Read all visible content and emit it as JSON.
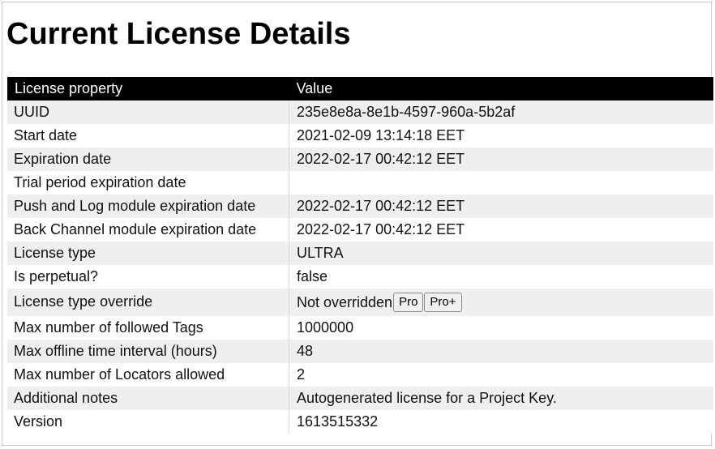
{
  "page": {
    "title": "Current License Details"
  },
  "table": {
    "headers": {
      "property": "License property",
      "value": "Value"
    },
    "rows": [
      {
        "property": "UUID",
        "value": "235e8e8a-8e1b-4597-960a-5b2af"
      },
      {
        "property": "Start date",
        "value": "2021-02-09 13:14:18 EET"
      },
      {
        "property": "Expiration date",
        "value": "2022-02-17 00:42:12 EET"
      },
      {
        "property": "Trial period expiration date",
        "value": ""
      },
      {
        "property": "Push and Log module expiration date",
        "value": "2022-02-17 00:42:12 EET"
      },
      {
        "property": "Back Channel module expiration date",
        "value": "2022-02-17 00:42:12 EET"
      },
      {
        "property": "License type",
        "value": "ULTRA"
      },
      {
        "property": "Is perpetual?",
        "value": "false"
      },
      {
        "property": "License type override",
        "value": "Not overridden"
      },
      {
        "property": "Max number of followed Tags",
        "value": "1000000"
      },
      {
        "property": "Max offline time interval (hours)",
        "value": "48"
      },
      {
        "property": "Max number of Locators allowed",
        "value": "2"
      },
      {
        "property": "Additional notes",
        "value": "Autogenerated license for a Project Key."
      },
      {
        "property": "Version",
        "value": "1613515332"
      }
    ]
  },
  "override_buttons": {
    "pro_label": "Pro",
    "pro_plus_label": "Pro+"
  },
  "colors": {
    "header_bg": "#000000",
    "header_text": "#ffffff",
    "row_alt_bg": "#efefef"
  }
}
